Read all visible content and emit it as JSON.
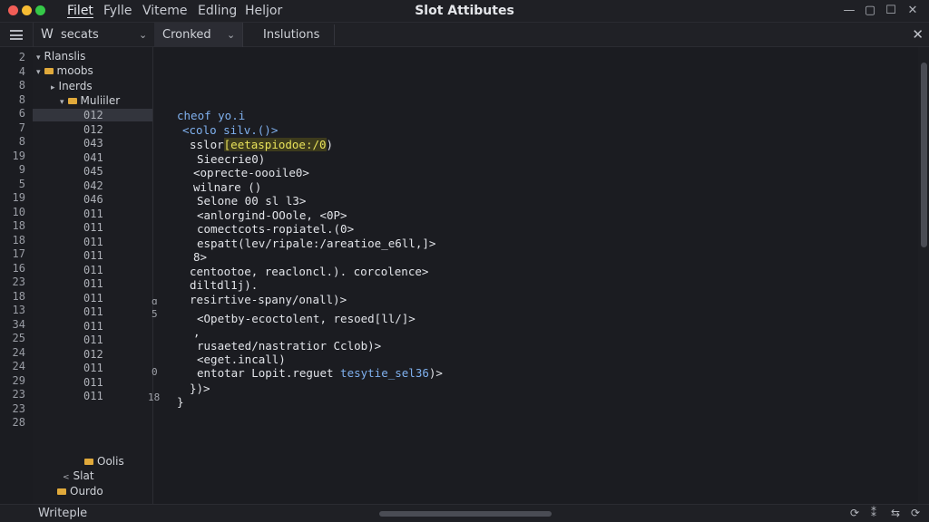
{
  "window": {
    "title": "Slot Attibutes",
    "menu": [
      "Filet",
      "Fylle",
      "Viteme",
      "Edling",
      "Heljor"
    ],
    "traffic_colors": [
      "#f25e57",
      "#f6bc33",
      "#35c948"
    ],
    "controls": [
      "—",
      "▢",
      "☐",
      "✕"
    ]
  },
  "toolbar": {
    "sidebar_w": "W",
    "sidebar_title": "secats",
    "tabs": [
      "Cronked",
      "Inslutions"
    ],
    "close": "✕"
  },
  "gutter": {
    "lines": [
      "2",
      "4",
      "8",
      "8",
      "6",
      "7",
      "8",
      "19",
      "9",
      "5",
      "19",
      "10",
      "18",
      "18",
      "17",
      "16",
      "23",
      "18",
      "13",
      "34",
      "25",
      "24",
      "24",
      "29",
      "23",
      "23",
      "28"
    ]
  },
  "explorer": {
    "items": [
      {
        "label": "Rlanslis",
        "arrow": "▾"
      },
      {
        "label": "moobs",
        "arrow": "▾"
      },
      {
        "label": "Inerds",
        "arrow": "▸"
      },
      {
        "label": "Muliiler",
        "arrow": "▾"
      }
    ],
    "numbers": [
      "012",
      "012",
      "043",
      "041",
      "045",
      "042",
      "046",
      "011",
      "011",
      "011",
      "011",
      "011",
      "011",
      "011",
      "011",
      "011",
      "011",
      "012",
      "011",
      "011",
      "011"
    ],
    "bottom": [
      {
        "label": "Oolis"
      },
      {
        "label": "Slat",
        "arrow": "<"
      },
      {
        "label": "Ourdo"
      }
    ]
  },
  "editor": {
    "gutter_marks": [
      "ɑ",
      "5",
      "0",
      "18"
    ],
    "lines": [
      {
        "text": "cheof yo.i",
        "kw": true
      },
      {
        "text": "<colo silv.()>",
        "kw": true
      },
      {
        "pre": "sslor",
        "hl": "[eetaspiodoe:/0",
        "post": ")"
      },
      {
        "text": "Sieecrie0)"
      },
      {
        "text": "<oprecte-oooile0>"
      },
      {
        "text": "wilnare ()"
      },
      {
        "text": "Selone 00 sl l3>"
      },
      {
        "text": "<anlorgind-OOole, <0P>"
      },
      {
        "text": "comectcots-ropiatel.(0>"
      },
      {
        "text": "espatt(lev/ripale:/areatioe_e6ll,]>"
      },
      {
        "text": "8>"
      },
      {
        "text": "centootoe, reacloncl.). corcolence>"
      },
      {
        "text": "diltdl1j)."
      },
      {
        "text": "resirtive-spany/onall)>"
      },
      {
        "text": "<Opetby-ecoctolent, resoed[ll/]>"
      },
      {
        "text": ","
      },
      {
        "text": "rusaeted/nastratior Cclob)>"
      },
      {
        "text": "<eget.incall)"
      },
      {
        "pre": "entotar Lopit.reguet ",
        "blue": "tesytie_sel36",
        "post": ")>"
      },
      {
        "text": "})>"
      },
      {
        "text": "}"
      }
    ]
  },
  "status": {
    "label": "Writeple",
    "icons": [
      "⟳",
      "⁑",
      "⇆",
      "⟳"
    ]
  }
}
